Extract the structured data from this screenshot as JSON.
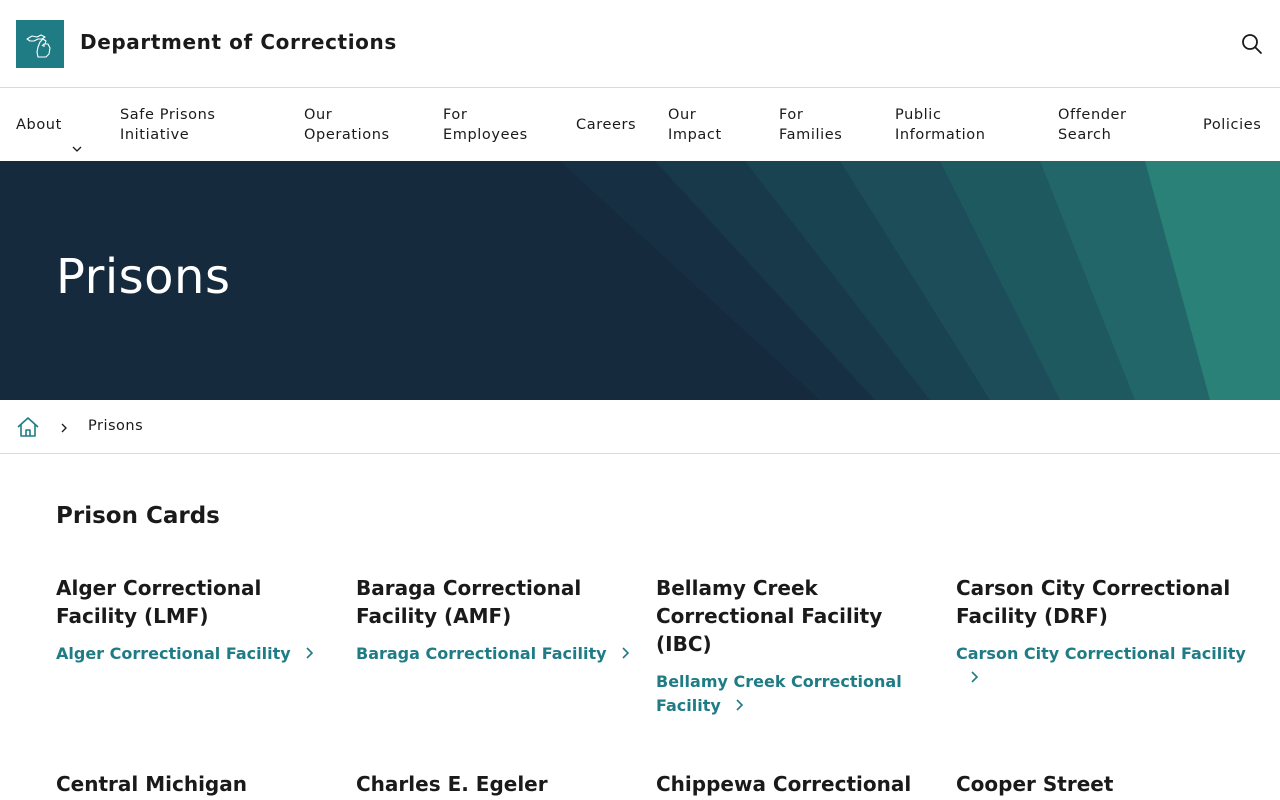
{
  "header": {
    "site_title": "Department of Corrections",
    "logo_icon": "michigan-state-icon",
    "search_icon": "search-icon"
  },
  "nav": {
    "items": [
      {
        "label": "About",
        "has_dropdown": true
      },
      {
        "label": "Safe Prisons\nInitiative"
      },
      {
        "label": "Our\nOperations"
      },
      {
        "label": "For\nEmployees"
      },
      {
        "label": "Careers"
      },
      {
        "label": "Our\nImpact"
      },
      {
        "label": "For\nFamilies"
      },
      {
        "label": "Public\nInformation"
      },
      {
        "label": "Offender\nSearch"
      },
      {
        "label": "Policies"
      }
    ]
  },
  "hero": {
    "title": "Prisons"
  },
  "breadcrumb": {
    "home_icon": "home-icon",
    "current": "Prisons"
  },
  "main": {
    "section_title": "Prison Cards",
    "cards": [
      {
        "title": "Alger Correctional Facility (LMF)",
        "link": "Alger Correctional Facility"
      },
      {
        "title": "Baraga Correctional Facility (AMF)",
        "link": "Baraga Correctional Facility"
      },
      {
        "title": "Bellamy Creek Correctional Facility (IBC)",
        "link": "Bellamy Creek Correctional Facility"
      },
      {
        "title": "Carson City Correctional Facility (DRF)",
        "link": "Carson City Correctional Facility"
      },
      {
        "title": "Central Michigan",
        "link": ""
      },
      {
        "title": "Charles E. Egeler",
        "link": ""
      },
      {
        "title": "Chippewa Correctional",
        "link": ""
      },
      {
        "title": "Cooper Street",
        "link": ""
      }
    ]
  },
  "colors": {
    "accent": "#1f7c85",
    "hero_dark": "#162a3e",
    "hero_teal": "#2a8178"
  }
}
